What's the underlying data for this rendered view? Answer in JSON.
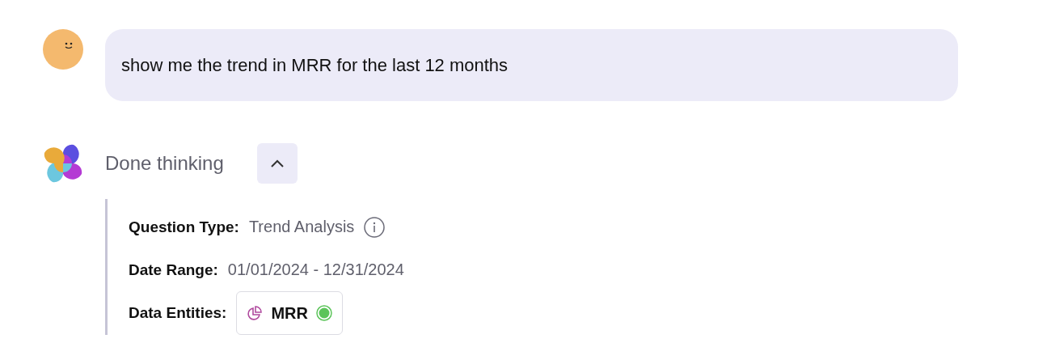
{
  "user_message": {
    "text": "show me the trend in MRR for the last 12 months"
  },
  "thinking": {
    "label": "Done thinking",
    "expanded": true
  },
  "details": [
    {
      "kind": "info",
      "label": "Question Type:",
      "value": "Trend Analysis"
    },
    {
      "kind": "text",
      "label": "Date Range:",
      "value": "01/01/2024 - 12/31/2024"
    },
    {
      "kind": "entity",
      "label": "Data Entities:",
      "value": "MRR",
      "color": "#5cc45a"
    }
  ]
}
